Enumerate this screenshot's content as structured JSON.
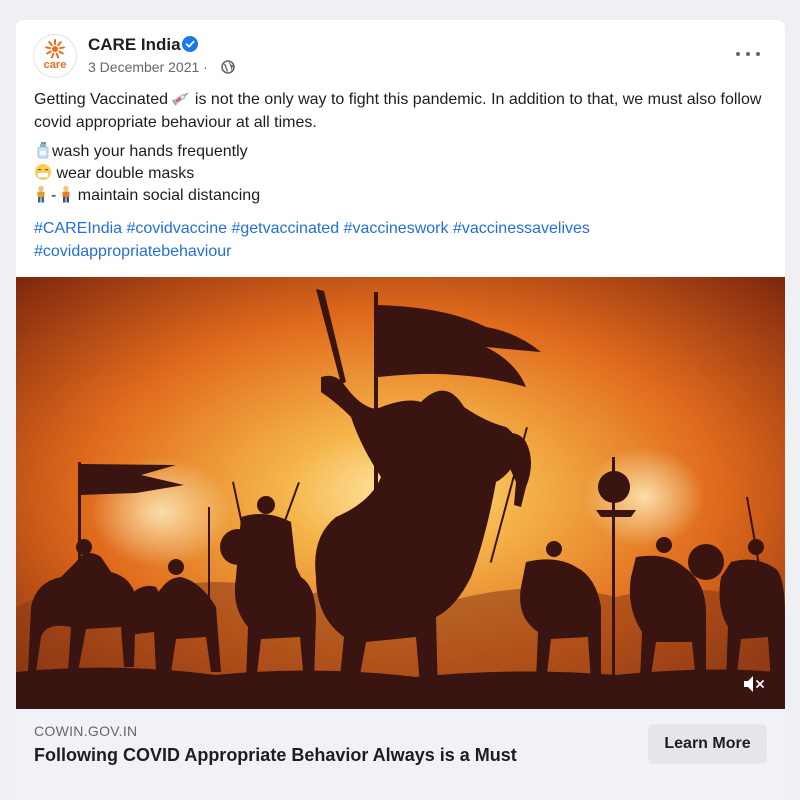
{
  "post": {
    "page_name": "CARE India",
    "date": "3 December 2021 ·",
    "text_line1_before": "Getting Vaccinated",
    "text_line1_after": " is not the only way to fight this pandemic. In addition to that, we must also follow covid appropriate behaviour at all times.",
    "bullets": [
      {
        "icon": "hand-sanitizer-icon",
        "text": "wash your hands frequently"
      },
      {
        "icon": "mask-face-icon",
        "text": " wear double masks"
      },
      {
        "icon": "person-distance-icon",
        "text": "maintain social distancing"
      }
    ],
    "distance_dash": "-",
    "hashtags": [
      "#CAREIndia",
      "#covidvaccine",
      "#getvaccinated",
      "#vaccineswork",
      "#vaccinessavelives",
      "#covidappropriatebehaviour"
    ]
  },
  "logo": {
    "text": "care",
    "color": "#f26a1b"
  },
  "link_preview": {
    "domain": "COWIN.GOV.IN",
    "headline": "Following COVID Appropriate Behavior Always is a Must",
    "cta_label": "Learn More"
  },
  "icons": {
    "verified": "verified-badge-icon",
    "audience": "globe-icon",
    "options": "more-options-icon",
    "mute": "muted-speaker-icon",
    "syringe": "syringe-icon"
  },
  "colors": {
    "link": "#216fdb",
    "verified": "#1877f2",
    "sky_glow": "#f5c25a",
    "silhouette": "#3a1410"
  }
}
